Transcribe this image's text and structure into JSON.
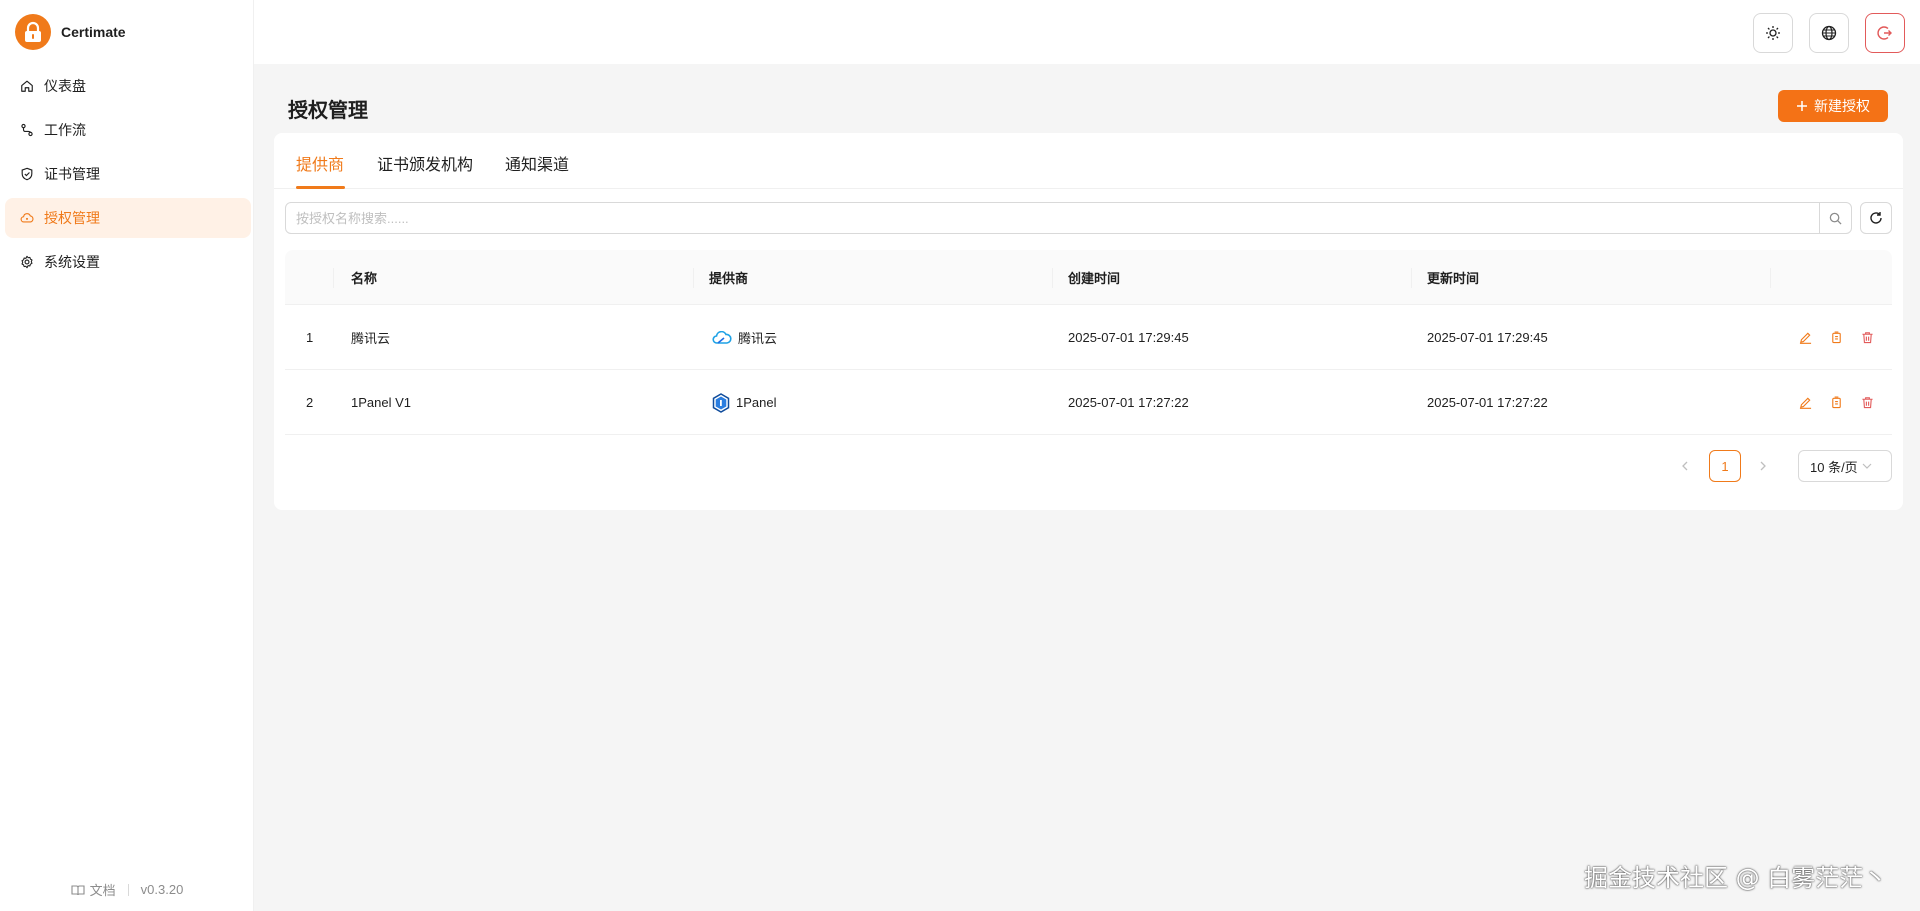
{
  "app": {
    "name": "Certimate",
    "version": "v0.3.20",
    "docs_label": "文档"
  },
  "colors": {
    "accent": "#f07a1a",
    "danger": "#e25a5a"
  },
  "sidebar": {
    "items": [
      {
        "label": "仪表盘",
        "icon": "home-icon",
        "active": false
      },
      {
        "label": "工作流",
        "icon": "workflow-icon",
        "active": false
      },
      {
        "label": "证书管理",
        "icon": "shield-check-icon",
        "active": false
      },
      {
        "label": "授权管理",
        "icon": "cloud-key-icon",
        "active": true
      },
      {
        "label": "系统设置",
        "icon": "gear-icon",
        "active": false
      }
    ]
  },
  "header": {
    "buttons": [
      {
        "icon": "sun-icon"
      },
      {
        "icon": "globe-icon"
      },
      {
        "icon": "logout-icon"
      }
    ]
  },
  "page": {
    "title": "授权管理",
    "new_button_label": "新建授权",
    "tabs": [
      {
        "label": "提供商",
        "active": true
      },
      {
        "label": "证书颁发机构",
        "active": false
      },
      {
        "label": "通知渠道",
        "active": false
      }
    ],
    "search": {
      "placeholder": "按授权名称搜索......",
      "value": ""
    }
  },
  "table": {
    "columns": [
      "名称",
      "提供商",
      "创建时间",
      "更新时间"
    ],
    "rows": [
      {
        "index": "1",
        "name": "腾讯云",
        "provider": "腾讯云",
        "provider_icon": "tencent-cloud-icon",
        "created": "2025-07-01 17:29:45",
        "updated": "2025-07-01 17:29:45"
      },
      {
        "index": "2",
        "name": "1Panel V1",
        "provider": "1Panel",
        "provider_icon": "1panel-icon",
        "created": "2025-07-01 17:27:22",
        "updated": "2025-07-01 17:27:22"
      }
    ]
  },
  "pagination": {
    "current_page": "1",
    "page_size_label": "10 条/页"
  },
  "watermark": "掘金技术社区 @ 白雾茫茫丶"
}
